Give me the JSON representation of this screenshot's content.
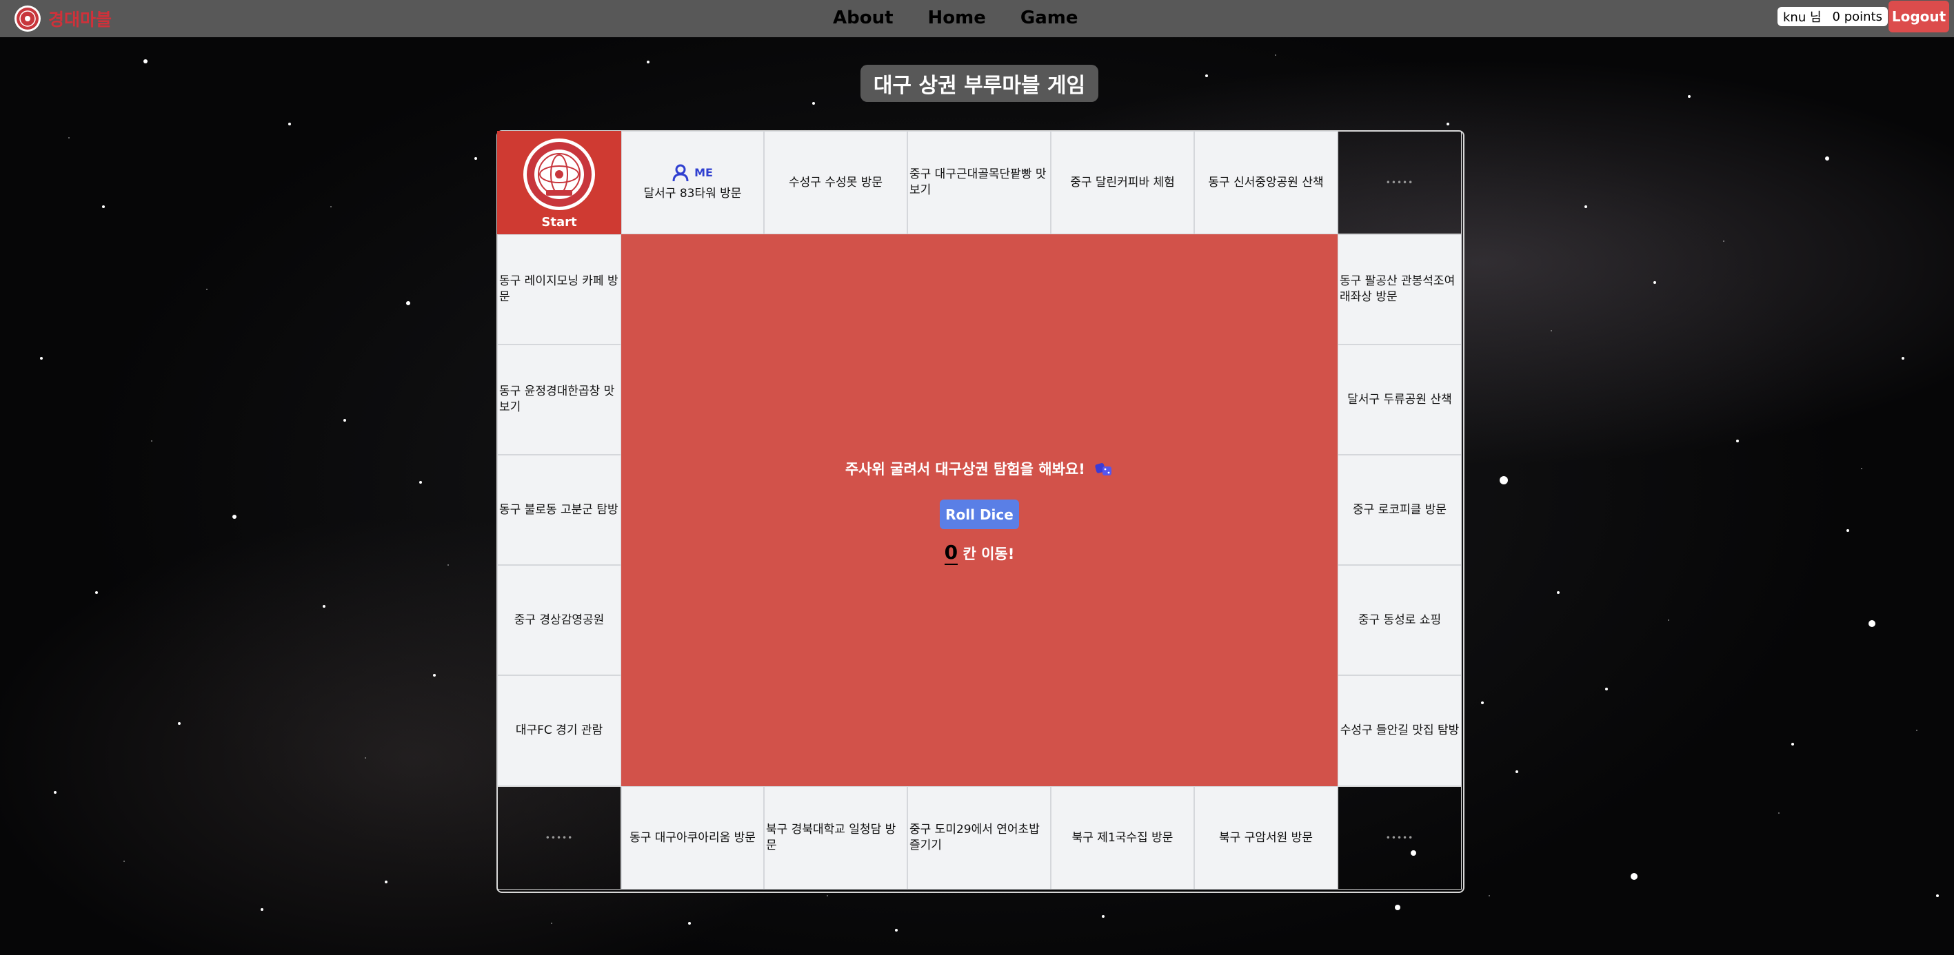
{
  "navbar": {
    "brand_name": "경대마블",
    "links": [
      "About",
      "Home",
      "Game"
    ],
    "user_name": "knu 님",
    "points": "0 points",
    "logout_label": "Logout"
  },
  "page_title": "대구 상권 부루마블 게임",
  "board": {
    "start_label": "Start",
    "me_label": "ME",
    "top": [
      "달서구 83타워 방문",
      "수성구 수성못 방문",
      "중구 대구근대골목단팥빵 맛보기",
      "중구 달린커피바 체험",
      "동구 신서중앙공원 산책"
    ],
    "left": [
      "동구 레이지모닝 카페 방문",
      "동구 윤정경대한곱창 맛보기",
      "동구 불로동 고분군 탐방",
      "중구 경상감영공원",
      "대구FC 경기 관람"
    ],
    "right": [
      "동구 팔공산 관봉석조여래좌상 방문",
      "달서구 두류공원 산책",
      "중구 로코피클 방문",
      "중구 동성로 쇼핑",
      "수성구 들안길 맛집 탐방"
    ],
    "bottom": [
      "동구 대구아쿠아리움 방문",
      "북구 경북대학교 일청담 방문",
      "중구 도미29에서 연어초밥 즐기기",
      "북구 제1국수집 방문",
      "북구 구암서원 방문"
    ],
    "corner_dots": "•••••"
  },
  "center": {
    "message": "주사위 굴려서 대구상권 탐험을 해봐요!",
    "roll_label": "Roll Dice",
    "move_count": "0",
    "move_suffix": "칸 이동!"
  },
  "colors": {
    "brand": "#d0313a",
    "board_center": "#d2524a",
    "start_cell": "#cf3a32",
    "roll_button": "#5a7fe6",
    "logout": "#dc4c4c",
    "cell_bg": "#f2f3f5"
  }
}
